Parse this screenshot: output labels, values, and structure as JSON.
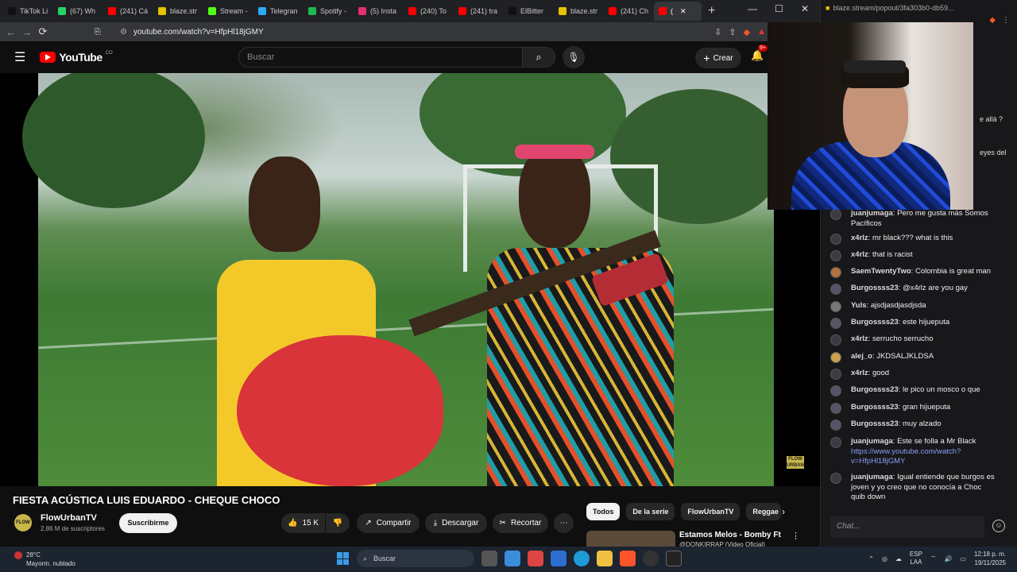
{
  "browser": {
    "tabs": [
      {
        "label": "TikTok Li",
        "color": "#111111"
      },
      {
        "label": "(67) Wh",
        "color": "#25d366"
      },
      {
        "label": "(241) Cá",
        "color": "#ff0000"
      },
      {
        "label": "blaze.str",
        "color": "#e6c200"
      },
      {
        "label": "Stream -",
        "color": "#53fc18"
      },
      {
        "label": "Telegran",
        "color": "#2aabee"
      },
      {
        "label": "Spotify -",
        "color": "#1db954"
      },
      {
        "label": "(5) Insta",
        "color": "#e1306c"
      },
      {
        "label": "(240) To",
        "color": "#ff0000"
      },
      {
        "label": "(241) tra",
        "color": "#ff0000"
      },
      {
        "label": "ElBitter",
        "color": "#111111"
      },
      {
        "label": "blaze.str",
        "color": "#e6c200"
      },
      {
        "label": "(241) Ch",
        "color": "#ff0000"
      },
      {
        "label": "(",
        "color": "#ff0000",
        "active": true
      }
    ],
    "url": "youtube.com/watch?v=HfpHl18jGMY",
    "popout_url": "blaze.stream/popout/3fa303b0-db59..."
  },
  "youtube": {
    "logo_text": "YouTube",
    "country": "CO",
    "search_placeholder": "Buscar",
    "create_label": "Crear",
    "notif_count": "9+",
    "video_watermark": "FLOW URBAN",
    "video_title": "FIESTA ACÚSTICA LUIS EDUARDO - CHEQUE CHOCO",
    "channel": {
      "name": "FlowUrbanTV",
      "subs": "2,86 M de suscriptores",
      "avatar_text": "FLOW"
    },
    "subscribe_label": "Suscribirme",
    "likes": "15 K",
    "share_label": "Compartir",
    "download_label": "Descargar",
    "clip_label": "Recortar",
    "chips": [
      "Todos",
      "De la serie",
      "FlowUrbanTV",
      "Reggae"
    ],
    "recommended": {
      "title": "Estamos Melos - Bomby Ft",
      "subtitle": "@DONKIRRAP (Video Oficial)"
    }
  },
  "chat": {
    "partial_lines": [
      "e allá ?",
      "eyes del"
    ],
    "messages": [
      {
        "user": "juanjumaga",
        "text": "Pero me gusta más Somos Pacíficos"
      },
      {
        "user": "x4rlz",
        "text": "mr black??? what is this"
      },
      {
        "user": "x4rlz",
        "text": "that is racist"
      },
      {
        "user": "SaemTwentyTwo",
        "text": "Colombia is great man"
      },
      {
        "user": "Burgossss23",
        "text": "@x4rlz are you gay"
      },
      {
        "user": "Yuls",
        "text": "ajsdjasdjasdjsda"
      },
      {
        "user": "Burgossss23",
        "text": "este hijueputa"
      },
      {
        "user": "x4rlz",
        "text": "serrucho serrucho"
      },
      {
        "user": "alej_o",
        "text": "JKDSALJKLDSA"
      },
      {
        "user": "x4rlz",
        "text": "good"
      },
      {
        "user": "Burgossss23",
        "text": "le pico un mosco o que"
      },
      {
        "user": "Burgossss23",
        "text": "gran hijueputa"
      },
      {
        "user": "Burgossss23",
        "text": "muy alzado"
      },
      {
        "user": "juanjumaga",
        "text": "Este se folla a Mr Black",
        "link": "https://www.youtube.com/watch?v=HfpHl18jGMY"
      },
      {
        "user": "juanjumaga",
        "text": "Igual entiende que burgos es joven y yo creo que no conocía a Choc quib down"
      }
    ],
    "input_placeholder": "Chat..."
  },
  "taskbar": {
    "weather_temp": "28°C",
    "weather_desc": "Mayorm. nublado",
    "search_label": "Buscar",
    "lang_top": "ESP",
    "lang_bottom": "LAA",
    "time": "12:18 p. m.",
    "date": "19/11/2025"
  }
}
